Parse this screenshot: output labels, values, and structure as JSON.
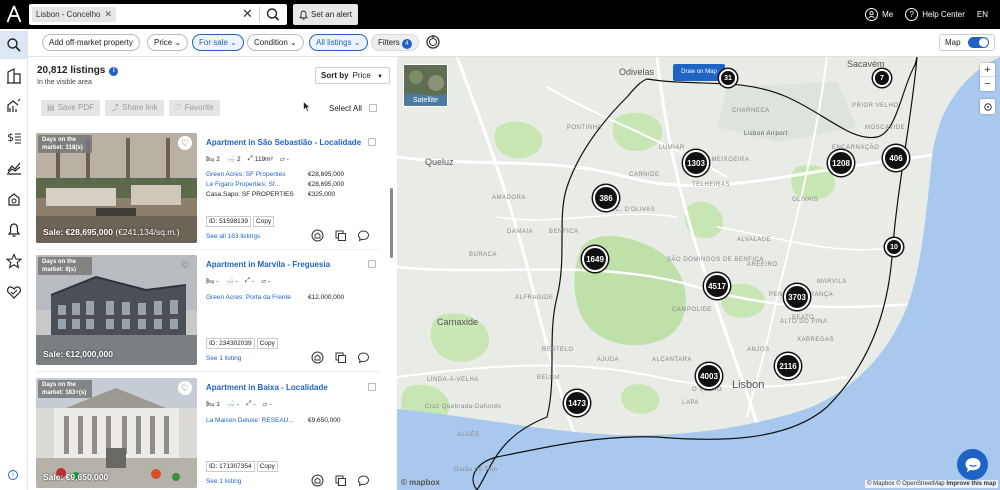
{
  "topbar": {
    "search_chip": "Lisbon - Concelho",
    "alert_label": "Set an alert",
    "me_label": "Me",
    "help_label": "Help Center",
    "lang_label": "EN"
  },
  "filters": {
    "add_off_market": "Add off-market property",
    "price": "Price",
    "for_sale": "For sale",
    "condition": "Condition",
    "all_listings": "All listings",
    "filters": "Filters",
    "filters_count": "4",
    "map_label": "Map"
  },
  "list": {
    "count": "20,812 listings",
    "visible_area": "In the visible area",
    "sort_by": "Sort by",
    "sort_value": "Price",
    "save_pdf": "Save PDF",
    "share_link": "Share link",
    "favorite": "Favorite",
    "select_all": "Select All"
  },
  "listings": [
    {
      "days_label": "Days on the market: 318(s)",
      "sale": "Sale: €28,695,000",
      "price_sqm": "(€241,134/sq.m.)",
      "title": "Apartment in São Sebastião - Localidade",
      "beds": "2",
      "baths": "2",
      "area": "119m²",
      "lot": "-",
      "parking": "-",
      "sources": [
        {
          "name": "Green Acres: SF Properties",
          "price": "€28,695,000",
          "linked": true
        },
        {
          "name": "Le Figaro Properties: Sf...",
          "price": "€28,695,000",
          "linked": true
        },
        {
          "name": "Casa.Sapo: SF PROPERTIES",
          "price": "€325,000",
          "linked": false
        }
      ],
      "id": "ID: 51598139",
      "copy": "Copy",
      "see_all": "See all 163 listings"
    },
    {
      "days_label": "Days on the market: 8(s)",
      "sale": "Sale: €12,000,000",
      "price_sqm": "",
      "title": "Apartment in Marvila - Freguesia",
      "beds": "-",
      "baths": "-",
      "area": "-",
      "lot": "-",
      "parking": "-",
      "sources": [
        {
          "name": "Green Acres: Porta da Frente",
          "price": "€12,000,000",
          "linked": true
        }
      ],
      "id": "ID: 234302039",
      "copy": "Copy",
      "see_all": "See 1 listing"
    },
    {
      "days_label": "Days on the market: 183+(s)",
      "sale": "Sale: €9,650,000",
      "price_sqm": "",
      "title": "Apartment in Baixa - Localidade",
      "beds": "1",
      "baths": "-",
      "area": "-",
      "lot": "-",
      "parking": "-",
      "sources": [
        {
          "name": "La Maison Deluxe: RESEAU...",
          "price": "€9,650,000",
          "linked": true
        }
      ],
      "id": "ID: 171307354",
      "copy": "Copy",
      "see_all": "See 1 listing"
    }
  ],
  "map": {
    "draw_label": "Draw on Map",
    "satellite_label": "Satellite",
    "zoom_in": "+",
    "zoom_out": "−",
    "clusters": [
      "31",
      "7",
      "1303",
      "1208",
      "406",
      "386",
      "10",
      "1649",
      "4517",
      "3703",
      "2116",
      "4003",
      "1473"
    ],
    "labels": {
      "odivelas": "Odivelas",
      "sacavem": "Sacavém",
      "charneca": "CHARNECA",
      "lisbon_airport": "Lisbon Airport",
      "queluz": "Queluz",
      "moscavide": "MOSCAVIDE",
      "benfica": "BENFICA",
      "lisbon": "Lisbon",
      "carnaxide": "Carnaxide",
      "alfragide": "ALFRAGIDE",
      "gaiao": "Gaião do Tejo",
      "quebrada": "Cruz Quebrada-Dafundo",
      "olivais": "OLIVAIS",
      "lumiar": "LUMIAR",
      "alvalade": "ALVALADE",
      "marvila": "MARVILA",
      "beato": "BEATO",
      "alcantara": "ALCANTARA",
      "belem": "BELÉM",
      "campolide": "CAMPOLIDE",
      "lapa": "LAPA",
      "penha": "PENHA DE FRANÇA",
      "anjos": "ANJOS",
      "carnide": "CARNIDE",
      "telheiras": "TELHEIRAS",
      "pontinha": "PONTINHA",
      "amadora": "AMADORA",
      "damaia": "DAMAIA",
      "restelo": "RESTELO",
      "ajuda": "AJUDA",
      "areeiro": "AREEIRO",
      "benfica_sul": "SÃO DOMINGOS DE BENFICA",
      "encarnacao": "ENCARNAÇÃO",
      "ameixoeira": "AMEIXOEIRA",
      "prior_velho": "PRIOR VELHO",
      "alto_pina": "ALTO DO PINA",
      "xabregas": "XABREGAS",
      "alcantara_d": "ALC. D'OLIVAS",
      "c_velho": "O VELHO",
      "buraca": "BURACA",
      "linda": "LINDA-A-VELHA",
      "algés": "ALGÉS"
    },
    "mapbox": "© mapbox",
    "attribution_1": "© Mapbox © OpenStreetMap",
    "attribution_2": "Improve this map"
  }
}
